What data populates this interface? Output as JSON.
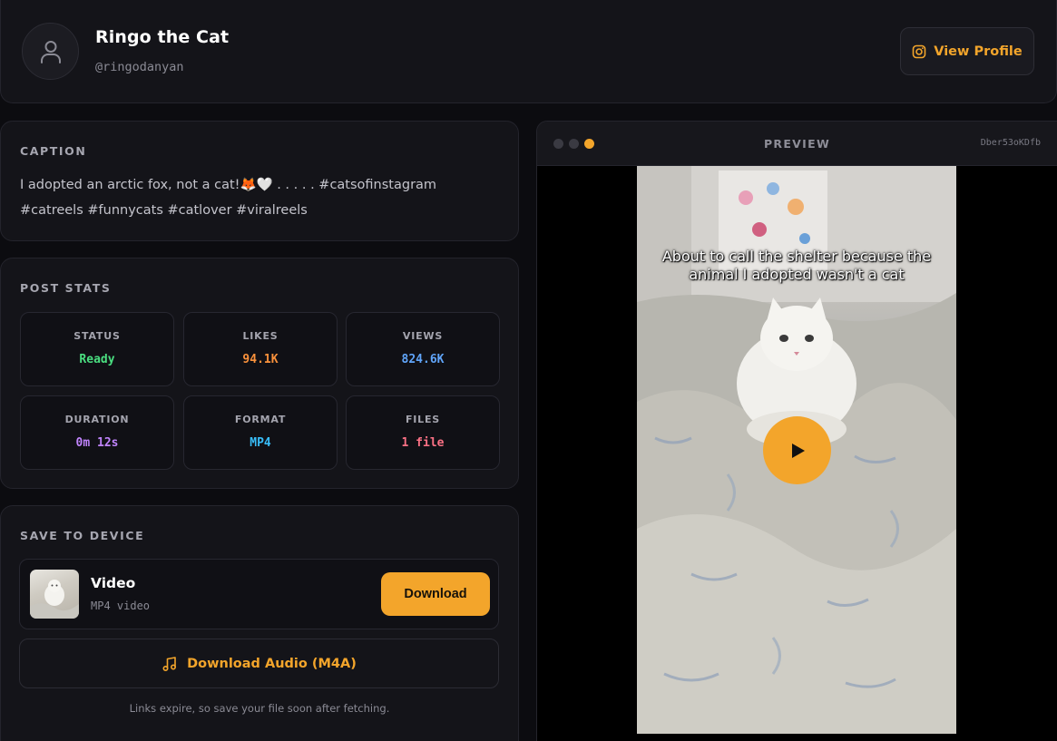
{
  "header": {
    "name": "Ringo the Cat",
    "handle": "@ringodanyan",
    "view_profile_label": "View Profile",
    "avatar_icon": "user-icon",
    "profile_icon": "instagram-icon"
  },
  "caption": {
    "title": "CAPTION",
    "text": "I adopted an arctic fox, not a cat!🦊🤍 . . . . . #catsofinstagram #catreels #funnycats #catlover #viralreels"
  },
  "stats": {
    "title": "POST STATS",
    "items": [
      {
        "label": "STATUS",
        "value": "Ready",
        "color": "#4ade80"
      },
      {
        "label": "LIKES",
        "value": "94.1K",
        "color": "#fb923c"
      },
      {
        "label": "VIEWS",
        "value": "824.6K",
        "color": "#60a5fa"
      },
      {
        "label": "DURATION",
        "value": "0m 12s",
        "color": "#c084fc"
      },
      {
        "label": "FORMAT",
        "value": "MP4",
        "color": "#38bdf8"
      },
      {
        "label": "FILES",
        "value": "1 file",
        "color": "#fb7185"
      }
    ]
  },
  "save": {
    "title": "SAVE TO DEVICE",
    "file_title": "Video",
    "file_subtitle": "MP4 video",
    "download_label": "Download",
    "audio_label": "Download Audio (M4A)",
    "audio_icon": "music-note-icon",
    "footnote": "Links expire, so save your file soon after fetching."
  },
  "preview": {
    "title": "PREVIEW",
    "id": "Dber53oKDfb",
    "overlay_text": "About to call the shelter because the animal I adopted wasn't a cat",
    "play_icon": "play-icon"
  },
  "colors": {
    "accent": "#f3a52b",
    "background": "#0c0c10",
    "panel": "#141419"
  }
}
